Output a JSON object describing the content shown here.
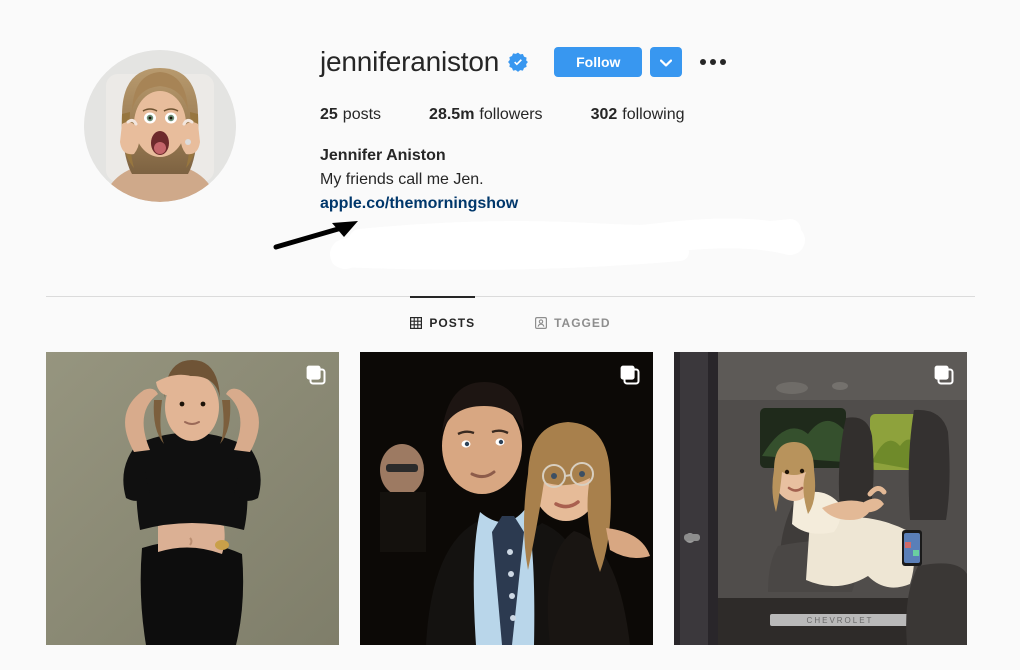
{
  "profile": {
    "username": "jenniferaniston",
    "verified": true,
    "verified_icon": "verified-badge-icon",
    "avatar_icon": "profile-avatar-image",
    "actions": {
      "follow_label": "Follow",
      "dropdown_icon": "chevron-down-icon",
      "options_icon": "more-options-icon",
      "accent_color": "#3897f0"
    },
    "stats": [
      {
        "value": "25",
        "label": "posts",
        "name": "posts"
      },
      {
        "value": "28.5m",
        "label": "followers",
        "name": "followers"
      },
      {
        "value": "302",
        "label": "following",
        "name": "following"
      }
    ],
    "bio": {
      "full_name": "Jennifer Aniston",
      "description": "My friends call me Jen.",
      "link": "apple.co/themorningshow",
      "link_color": "#00376b"
    }
  },
  "annotations": {
    "arrow": {
      "name": "annotation-arrow",
      "color": "#000000"
    },
    "redaction": {
      "name": "redaction-brush-stroke",
      "color": "#ffffff"
    }
  },
  "tabs": [
    {
      "label": "POSTS",
      "icon": "grid-icon",
      "active": true,
      "name": "tab-posts"
    },
    {
      "label": "TAGGED",
      "icon": "tagged-person-icon",
      "active": false,
      "name": "tab-tagged"
    }
  ],
  "posts": [
    {
      "name": "post-tile-1",
      "description": "Woman in black cutout dress posing against olive backdrop",
      "badge_icon": "carousel-icon",
      "bg": "#8e8d7b"
    },
    {
      "name": "post-tile-2",
      "description": "Vintage photo of a man in suit and woman with glasses on dark background",
      "badge_icon": "carousel-icon",
      "bg": "#0d0a06"
    },
    {
      "name": "post-tile-3",
      "description": "Woman in cream outfit seated inside an SUV interior",
      "badge_icon": "carousel-icon",
      "bg": "#4a4a4a"
    }
  ],
  "theme": {
    "background": "#fafafa",
    "text": "#262626",
    "muted": "#8e8e8e",
    "divider": "#dbdbdb"
  }
}
